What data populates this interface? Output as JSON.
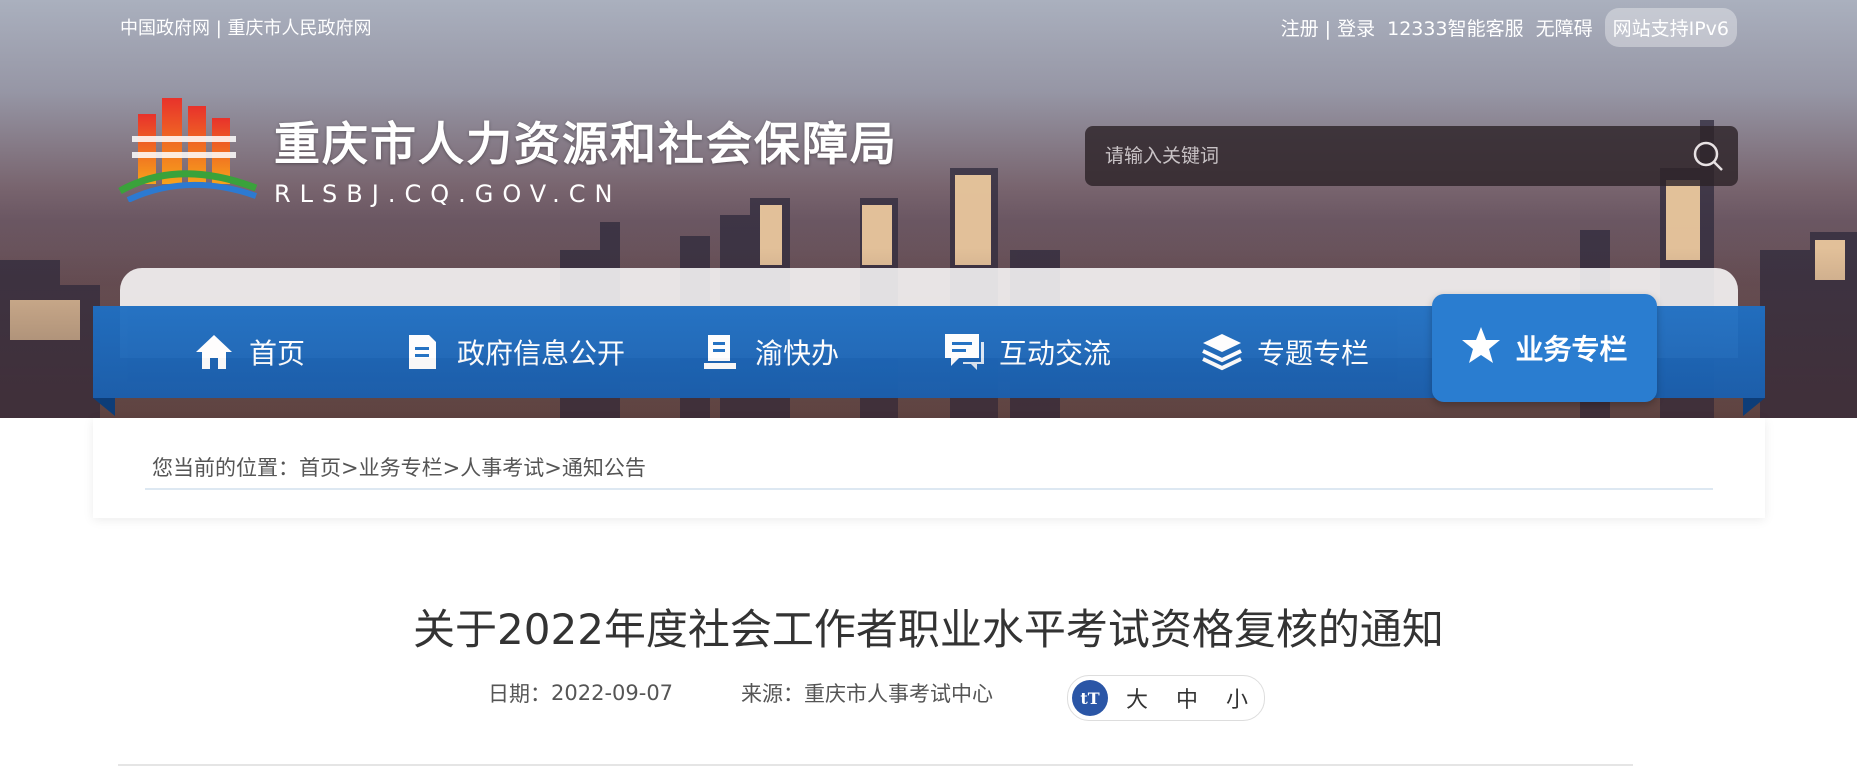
{
  "topbar": {
    "gov_link": "中国政府网",
    "separator": " | ",
    "city_link": "重庆市人民政府网",
    "register": "注册",
    "login_sep": " | ",
    "login": "登录",
    "service": "12333智能客服",
    "accessibility": "无障碍",
    "ipv6": "网站支持IPv6"
  },
  "site": {
    "name": "重庆市人力资源和社会保障局",
    "domain": "RLSBJ.CQ.GOV.CN"
  },
  "search": {
    "placeholder": "请输入关键词"
  },
  "nav": {
    "items": [
      {
        "label": "首页",
        "icon": "home-icon"
      },
      {
        "label": "政府信息公开",
        "icon": "document-icon"
      },
      {
        "label": "渝快办",
        "icon": "book-icon"
      },
      {
        "label": "互动交流",
        "icon": "chat-icon"
      },
      {
        "label": "专题专栏",
        "icon": "layers-icon"
      },
      {
        "label": "业务专栏",
        "icon": "star-icon",
        "active": true
      }
    ]
  },
  "breadcrumb": {
    "prefix": "您当前的位置：",
    "items": [
      "首页",
      "业务专栏",
      "人事考试",
      "通知公告"
    ],
    "sep": ">"
  },
  "article": {
    "title": "关于2022年度社会工作者职业水平考试资格复核的通知",
    "date_label": "日期：",
    "date": "2022-09-07",
    "source_label": "来源：",
    "source": "重庆市人事考试中心",
    "font_size": {
      "icon": "tT",
      "large": "大",
      "medium": "中",
      "small": "小"
    }
  },
  "colors": {
    "nav_blue": "#1f6fc2",
    "nav_active": "#2a7dd0",
    "font_badge": "#2b56a6"
  }
}
